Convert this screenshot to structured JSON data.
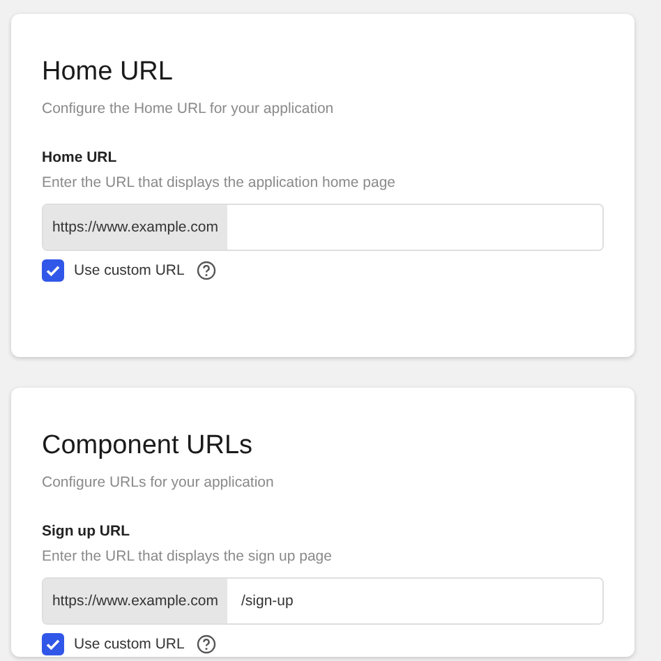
{
  "sections": [
    {
      "title": "Home URL",
      "subtitle": "Configure the Home URL for your application",
      "fields": [
        {
          "label": "Home URL",
          "hint": "Enter the URL that displays the application home page",
          "prefix": "https://www.example.com",
          "checkbox": {
            "label": "Use custom URL",
            "checked": true
          }
        }
      ]
    },
    {
      "title": "Component URLs",
      "subtitle": "Configure URLs for your application",
      "fields": [
        {
          "label": "Sign up URL",
          "hint": "Enter the URL that displays the sign up page",
          "prefix": "https://www.example.com",
          "value": "/sign-up",
          "checkbox": {
            "label": "Use custom URL",
            "checked": true
          }
        }
      ]
    }
  ]
}
